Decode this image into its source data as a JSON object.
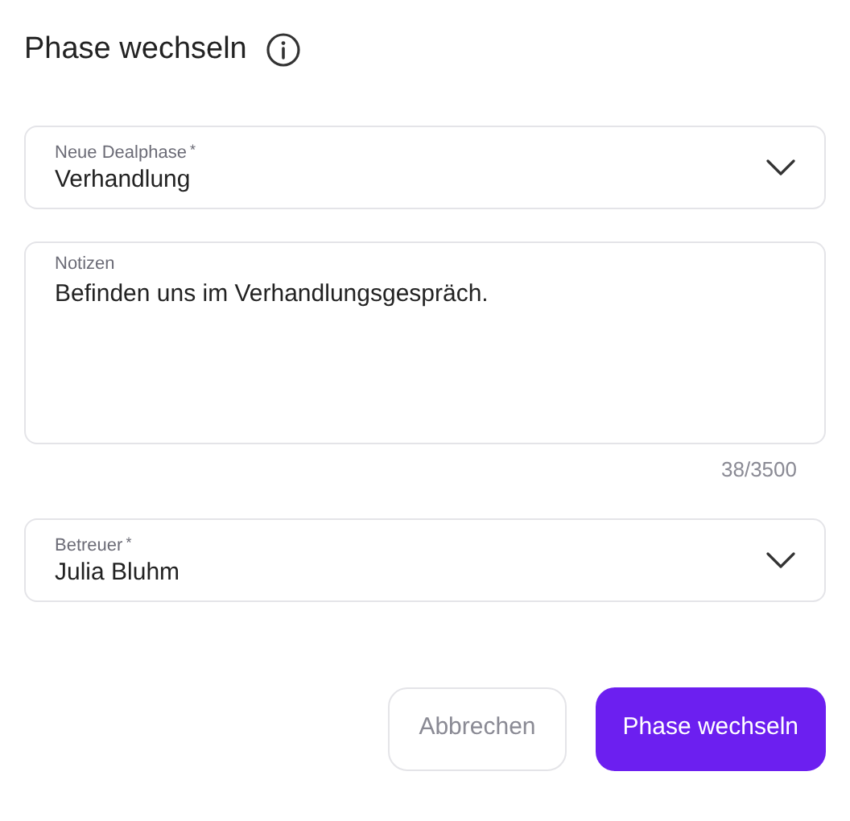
{
  "title": "Phase wechseln",
  "fields": [
    {
      "kind": "select",
      "label": "Neue Dealphase",
      "required": "*",
      "value": "Verhandlung"
    },
    {
      "kind": "textarea",
      "label": "Notizen",
      "value": "Befinden uns im Verhandlungsgespräch.",
      "counter": "38/3500"
    },
    {
      "kind": "select",
      "label": "Betreuer",
      "required": "*",
      "value": "Julia Bluhm"
    }
  ],
  "buttons": [
    {
      "label": "Abbrechen",
      "kind": "secondary"
    },
    {
      "label": "Phase wechseln",
      "kind": "primary"
    }
  ]
}
